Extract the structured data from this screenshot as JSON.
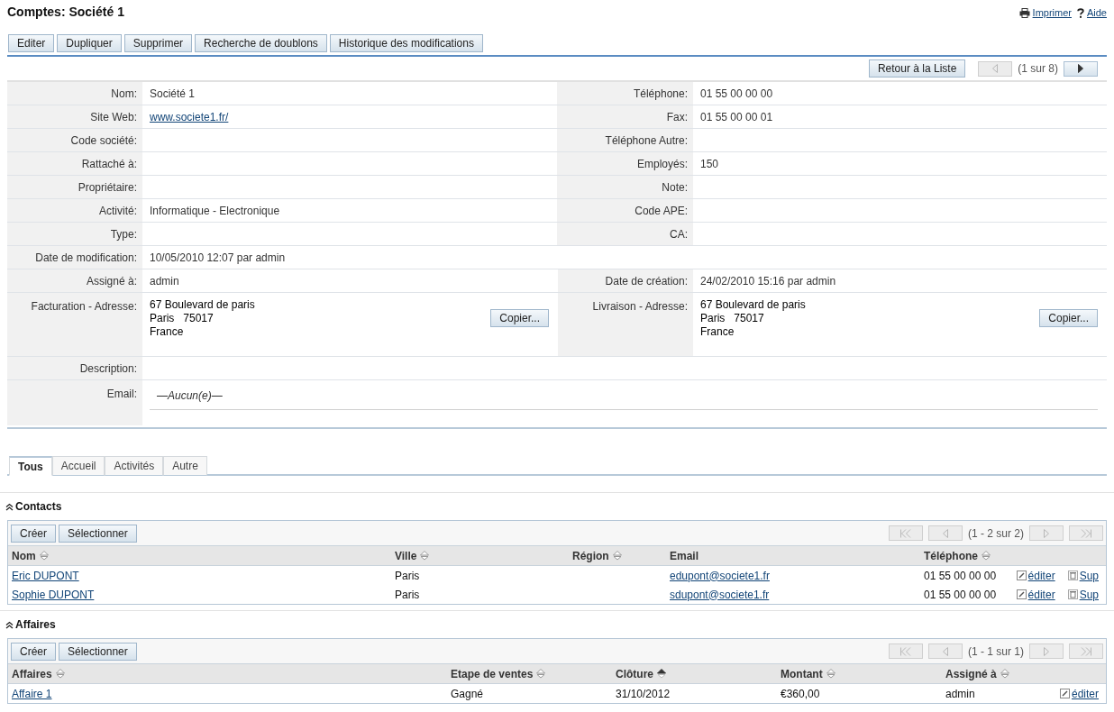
{
  "title": "Comptes: Société 1",
  "header_links": [
    {
      "kind": "print",
      "label": "Imprimer"
    },
    {
      "kind": "help",
      "label": "Aide"
    }
  ],
  "actions": [
    "Editer",
    "Dupliquer",
    "Supprimer",
    "Recherche de doublons",
    "Historique des modifications"
  ],
  "nav": {
    "back": "Retour à la Liste",
    "pager": {
      "before": [
        {
          "kind": "prev",
          "disabled": true
        }
      ],
      "label": "(1 sur 8)",
      "after": [
        {
          "kind": "next",
          "disabled": false
        }
      ]
    }
  },
  "detail_rows": [
    {
      "kind": "pair",
      "cells": [
        {
          "label": "Nom:",
          "value": "Société 1"
        },
        {
          "label": "Téléphone:",
          "value": "01 55 00 00 00"
        }
      ]
    },
    {
      "kind": "pair",
      "cells": [
        {
          "label": "Site Web:",
          "value": "www.societe1.fr/",
          "link": true
        },
        {
          "label": "Fax:",
          "value": "01 55 00 00 01"
        }
      ]
    },
    {
      "kind": "pair",
      "cells": [
        {
          "label": "Code société:"
        },
        {
          "label": "Téléphone Autre:"
        }
      ]
    },
    {
      "kind": "pair",
      "cells": [
        {
          "label": "Rattaché à:"
        },
        {
          "label": "Employés:",
          "value": "150"
        }
      ]
    },
    {
      "kind": "pair",
      "cells": [
        {
          "label": "Propriétaire:"
        },
        {
          "label": "Note:"
        }
      ]
    },
    {
      "kind": "pair",
      "cells": [
        {
          "label": "Activité:",
          "value": "Informatique - Electronique"
        },
        {
          "label": "Code APE:"
        }
      ]
    },
    {
      "kind": "pair",
      "cells": [
        {
          "label": "Type:"
        },
        {
          "label": "CA:"
        }
      ]
    },
    {
      "kind": "wide",
      "cells": [
        {
          "label": "Date de modification:",
          "value": "10/05/2010 12:07 par admin"
        }
      ]
    },
    {
      "kind": "plain",
      "cells": [
        {
          "label": "Assigné à:",
          "value": "admin"
        },
        {
          "label": "Date de création:",
          "value": "24/02/2010 15:16 par admin"
        }
      ]
    },
    {
      "kind": "address",
      "cells": [
        {
          "label": "Facturation - Adresse:",
          "lines": [
            "67 Boulevard de paris",
            "Paris   75017",
            "France"
          ],
          "button": "Copier..."
        },
        {
          "label": "Livraison - Adresse:",
          "lines": [
            "67 Boulevard de paris",
            "Paris   75017",
            "France"
          ],
          "button": "Copier..."
        }
      ]
    },
    {
      "kind": "wide",
      "cells": [
        {
          "label": "Description:"
        }
      ]
    },
    {
      "kind": "email",
      "cells": [
        {
          "label": "Email:",
          "value": "—Aucun(e)—"
        }
      ]
    }
  ],
  "tabs": [
    {
      "label": "Tous",
      "selected": true
    },
    {
      "label": "Accueil",
      "selected": false
    },
    {
      "label": "Activités",
      "selected": false
    },
    {
      "label": "Autre",
      "selected": false
    }
  ],
  "subpanels": [
    {
      "title": "Contacts",
      "buttons": [
        "Créer",
        "Sélectionner"
      ],
      "pager": {
        "before": [
          {
            "kind": "first",
            "disabled": true
          },
          {
            "kind": "prev",
            "disabled": true
          }
        ],
        "label": "(1 - 2 sur 2)",
        "after": [
          {
            "kind": "next",
            "disabled": true
          },
          {
            "kind": "last",
            "disabled": true
          }
        ]
      },
      "columns": [
        {
          "label": "Nom",
          "sortable": true,
          "sorted": false
        },
        {
          "label": "Ville",
          "sortable": true,
          "sorted": false
        },
        {
          "label": "Région",
          "sortable": true,
          "sorted": false
        },
        {
          "label": "Email",
          "sortable": false
        },
        {
          "label": "Téléphone",
          "sortable": true,
          "sorted": false
        }
      ],
      "rows": [
        {
          "cells": [
            {
              "text": "Eric DUPONT",
              "link": true
            },
            {
              "text": "Paris"
            },
            {},
            {
              "text": "edupont@societe1.fr",
              "link": true
            },
            {
              "text": "01 55 00 00 00"
            }
          ],
          "actions": [
            {
              "kind": "edit",
              "label": "éditer"
            },
            {
              "kind": "delete",
              "label": "Sup"
            }
          ]
        },
        {
          "cells": [
            {
              "text": "Sophie DUPONT",
              "link": true
            },
            {
              "text": "Paris"
            },
            {},
            {
              "text": "sdupont@societe1.fr",
              "link": true
            },
            {
              "text": "01 55 00 00 00"
            }
          ],
          "actions": [
            {
              "kind": "edit",
              "label": "éditer"
            },
            {
              "kind": "delete",
              "label": "Sup"
            }
          ]
        }
      ]
    },
    {
      "title": "Affaires",
      "buttons": [
        "Créer",
        "Sélectionner"
      ],
      "pager": {
        "before": [
          {
            "kind": "first",
            "disabled": true
          },
          {
            "kind": "prev",
            "disabled": true
          }
        ],
        "label": "(1 - 1 sur 1)",
        "after": [
          {
            "kind": "next",
            "disabled": true
          },
          {
            "kind": "last",
            "disabled": true
          }
        ]
      },
      "columns": [
        {
          "label": "Affaires",
          "sortable": true,
          "sorted": false
        },
        {
          "label": "Etape de ventes",
          "sortable": true,
          "sorted": false
        },
        {
          "label": "Clôture",
          "sortable": true,
          "sorted": true
        },
        {
          "label": "Montant",
          "sortable": true,
          "sorted": false
        },
        {
          "label": "Assigné à",
          "sortable": true,
          "sorted": false
        }
      ],
      "rows": [
        {
          "cells": [
            {
              "text": "Affaire 1",
              "link": true
            },
            {
              "text": "Gagné"
            },
            {
              "text": "31/10/2012"
            },
            {
              "text": "€360,00"
            },
            {
              "text": "admin"
            }
          ],
          "actions": [
            {
              "kind": "edit",
              "label": "éditer"
            }
          ]
        }
      ]
    }
  ]
}
